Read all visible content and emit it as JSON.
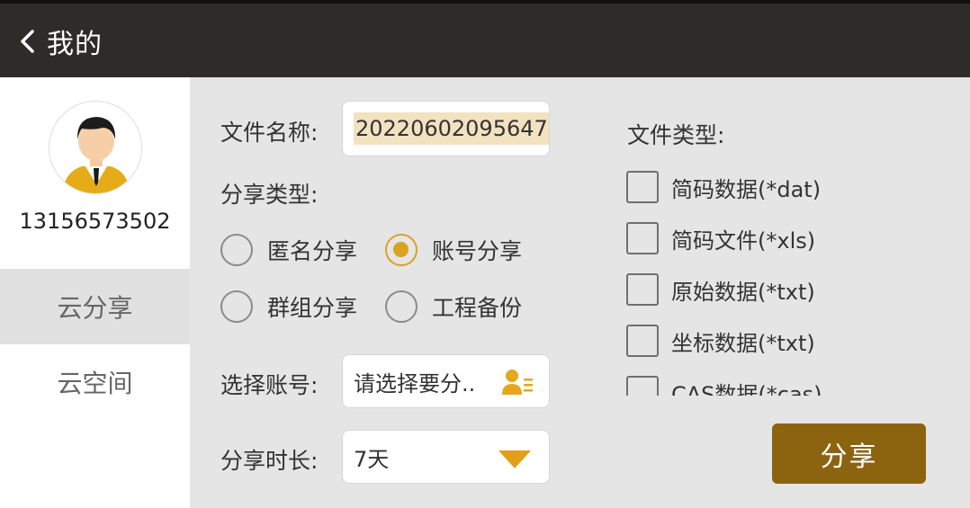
{
  "header": {
    "title": "我的"
  },
  "sidebar": {
    "phone": "13156573502",
    "items": [
      {
        "label": "云分享",
        "active": true
      },
      {
        "label": "云空间",
        "active": false
      }
    ]
  },
  "form": {
    "file_name_label": "文件名称:",
    "file_name_value": "20220602095647",
    "share_type_label": "分享类型:",
    "share_types": [
      {
        "label": "匿名分享",
        "selected": false
      },
      {
        "label": "账号分享",
        "selected": true
      },
      {
        "label": "群组分享",
        "selected": false
      },
      {
        "label": "工程备份",
        "selected": false
      }
    ],
    "account_label": "选择账号:",
    "account_placeholder": "请选择要分..",
    "duration_label": "分享时长:",
    "duration_value": "7天"
  },
  "file_types": {
    "label": "文件类型:",
    "options": [
      {
        "label": "简码数据(*dat)",
        "checked": false
      },
      {
        "label": "简码文件(*xls)",
        "checked": false
      },
      {
        "label": "原始数据(*txt)",
        "checked": false
      },
      {
        "label": "坐标数据(*txt)",
        "checked": false
      },
      {
        "label": "CAS数据(*cas)",
        "checked": false
      }
    ]
  },
  "share_button": "分享",
  "colors": {
    "header_bg": "#2d2c29",
    "accent": "#d9a320",
    "share_button": "#8c6410",
    "highlight": "#f3e2c0"
  },
  "icons": [
    "chevron-left-icon",
    "avatar-icon",
    "contact-select-icon",
    "dropdown-triangle-icon"
  ]
}
